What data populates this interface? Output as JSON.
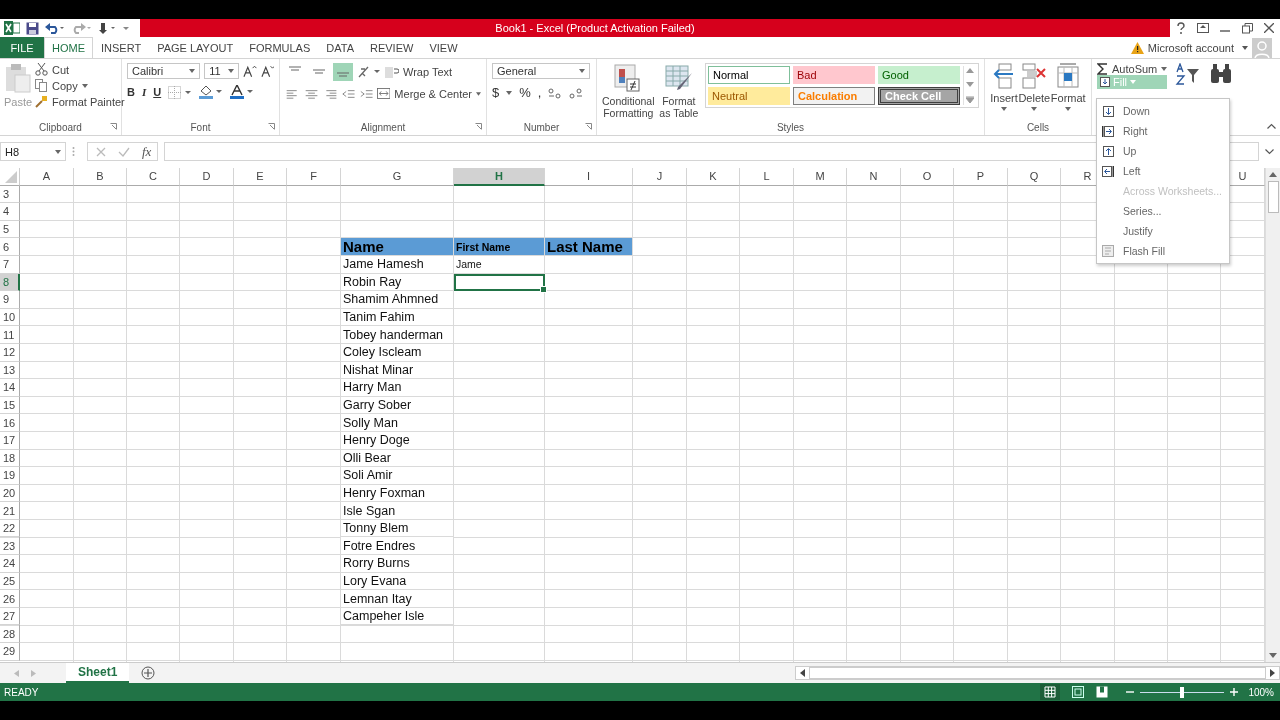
{
  "window": {
    "title": "Book1 -  Excel (Product Activation Failed)"
  },
  "tabs": [
    {
      "label": "FILE",
      "kind": "file",
      "selected": false
    },
    {
      "label": "HOME",
      "kind": "tab",
      "selected": true
    },
    {
      "label": "INSERT",
      "kind": "tab",
      "selected": false
    },
    {
      "label": "PAGE LAYOUT",
      "kind": "tab",
      "selected": false
    },
    {
      "label": "FORMULAS",
      "kind": "tab",
      "selected": false
    },
    {
      "label": "DATA",
      "kind": "tab",
      "selected": false
    },
    {
      "label": "REVIEW",
      "kind": "tab",
      "selected": false
    },
    {
      "label": "VIEW",
      "kind": "tab",
      "selected": false
    }
  ],
  "account": {
    "label": "Microsoft account"
  },
  "ribbon": {
    "clipboard": {
      "label": "Clipboard",
      "paste": "Paste",
      "cut": "Cut",
      "copy": "Copy",
      "format_painter": "Format Painter"
    },
    "font": {
      "label": "Font",
      "family": "Calibri",
      "size": "11",
      "bold": "B",
      "italic": "I",
      "underline": "U"
    },
    "alignment": {
      "label": "Alignment",
      "wrap_text": "Wrap Text",
      "merge": "Merge & Center",
      "vertical": [
        {
          "selected": false
        },
        {
          "selected": false
        },
        {
          "selected": true
        }
      ]
    },
    "number": {
      "label": "Number",
      "format": "General",
      "currency": "$",
      "percent": "%",
      "comma": ","
    },
    "styles": {
      "label": "Styles",
      "conditional": "Conditional Formatting",
      "format_table": "Format as Table",
      "cells": [
        {
          "label": "Normal",
          "kind": "normal"
        },
        {
          "label": "Bad",
          "kind": "bad"
        },
        {
          "label": "Good",
          "kind": "good"
        },
        {
          "label": "Neutral",
          "kind": "neutral"
        },
        {
          "label": "Calculation",
          "kind": "calculation"
        },
        {
          "label": "Check Cell",
          "kind": "check"
        }
      ]
    },
    "cells": {
      "label": "Cells",
      "insert": "Insert",
      "delete": "Delete",
      "format": "Format"
    },
    "editing": {
      "autosum": "AutoSum",
      "fill": "Fill",
      "fill_open": true
    }
  },
  "fill_menu": [
    {
      "label": "Down",
      "kind": "down",
      "disabled": false
    },
    {
      "label": "Right",
      "kind": "right",
      "disabled": false
    },
    {
      "label": "Up",
      "kind": "up",
      "disabled": false
    },
    {
      "label": "Left",
      "kind": "left",
      "disabled": false
    },
    {
      "label": "Across Worksheets...",
      "kind": "plain",
      "disabled": true
    },
    {
      "label": "Series...",
      "kind": "plain",
      "disabled": false
    },
    {
      "label": "Justify",
      "kind": "plain",
      "disabled": false
    },
    {
      "label": "Flash Fill",
      "kind": "flash",
      "disabled": false
    }
  ],
  "formula_bar": {
    "name_box": "H8",
    "function_label": "fx"
  },
  "columns": [
    {
      "label": "A",
      "selected": false
    },
    {
      "label": "B",
      "selected": false
    },
    {
      "label": "C",
      "selected": false
    },
    {
      "label": "D",
      "selected": false
    },
    {
      "label": "E",
      "selected": false
    },
    {
      "label": "F",
      "selected": false
    },
    {
      "label": "G",
      "selected": false
    },
    {
      "label": "H",
      "selected": true
    },
    {
      "label": "I",
      "selected": false
    },
    {
      "label": "J",
      "selected": false
    },
    {
      "label": "K",
      "selected": false
    },
    {
      "label": "L",
      "selected": false
    },
    {
      "label": "M",
      "selected": false
    },
    {
      "label": "N",
      "selected": false
    },
    {
      "label": "O",
      "selected": false
    },
    {
      "label": "P",
      "selected": false
    },
    {
      "label": "Q",
      "selected": false
    },
    {
      "label": "R",
      "selected": false
    },
    {},
    {},
    {
      "label": "U",
      "selected": false
    }
  ],
  "rows": [
    {
      "number": "3",
      "selected": false
    },
    {
      "number": "4",
      "selected": false
    },
    {
      "number": "5",
      "selected": false
    },
    {
      "number": "6",
      "kind": "header",
      "selected": false,
      "g": "Name",
      "h": "First Name",
      "i": "Last Name"
    },
    {
      "number": "7",
      "selected": false,
      "g": "Jame Hamesh",
      "h": "Jame"
    },
    {
      "number": "8",
      "selected": true,
      "g": "Robin Ray"
    },
    {
      "number": "9",
      "selected": false,
      "g": "Shamim Ahmned"
    },
    {
      "number": "10",
      "selected": false,
      "g": "Tanim Fahim"
    },
    {
      "number": "11",
      "selected": false,
      "g": "Tobey handerman"
    },
    {
      "number": "12",
      "selected": false,
      "g": "Coley Iscleam"
    },
    {
      "number": "13",
      "selected": false,
      "g": "Nishat Minar"
    },
    {
      "number": "14",
      "selected": false,
      "g": "Harry Man"
    },
    {
      "number": "15",
      "selected": false,
      "g": "Garry Sober"
    },
    {
      "number": "16",
      "selected": false,
      "g": "Solly Man"
    },
    {
      "number": "17",
      "selected": false,
      "g": "Henry Doge"
    },
    {
      "number": "18",
      "selected": false,
      "g": "Olli Bear"
    },
    {
      "number": "19",
      "selected": false,
      "g": "Soli Amir"
    },
    {
      "number": "20",
      "selected": false,
      "g": "Henry Foxman"
    },
    {
      "number": "21",
      "selected": false,
      "g": "Isle Sgan"
    },
    {
      "number": "22",
      "selected": false,
      "g": "Tonny Blem"
    },
    {
      "number": "23",
      "selected": false,
      "g": "Fotre Endres"
    },
    {
      "number": "24",
      "selected": false,
      "g": "Rorry Burns"
    },
    {
      "number": "25",
      "selected": false,
      "g": "Lory Evana"
    },
    {
      "number": "26",
      "selected": false,
      "g": "Lemnan Itay"
    },
    {
      "number": "27",
      "selected": false,
      "g": "Campeher Isle"
    },
    {
      "number": "28",
      "selected": false
    },
    {
      "number": "29",
      "selected": false
    }
  ],
  "sheets": [
    {
      "label": "Sheet1",
      "selected": true
    }
  ],
  "status_bar": {
    "status": "READY",
    "zoom": "100%",
    "zoom_level": {
      "level": 0.5
    }
  }
}
